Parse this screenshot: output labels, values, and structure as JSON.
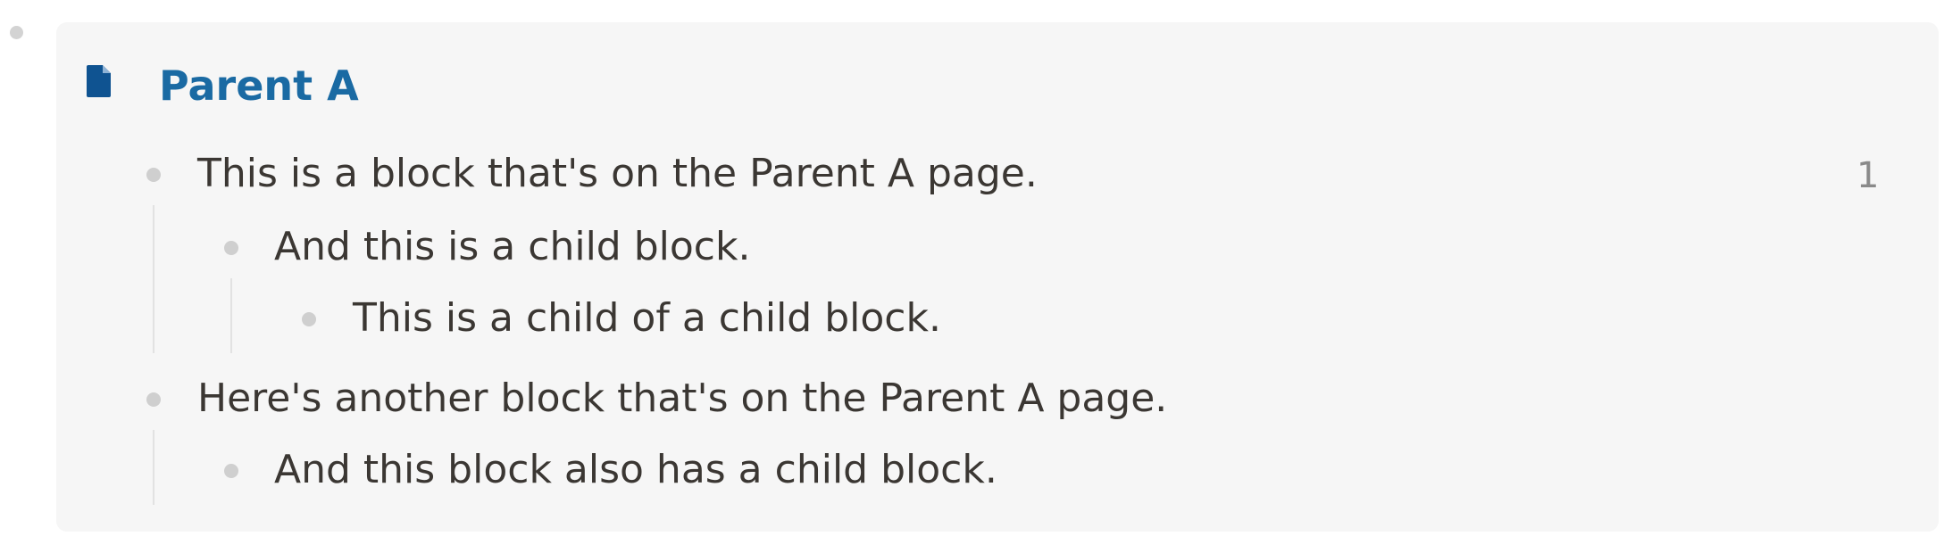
{
  "page": {
    "title": "Parent A",
    "icon": "page-icon"
  },
  "blocks": [
    {
      "text": "This is a block that's on the Parent A page.",
      "depth": 0,
      "ref_count": "1"
    },
    {
      "text": "And this is a child block.",
      "depth": 1
    },
    {
      "text": "This is a child of a child block.",
      "depth": 2
    },
    {
      "text": "Here's another block that's on the Parent A page.",
      "depth": 0
    },
    {
      "text": "And this block also has a child block.",
      "depth": 1
    }
  ],
  "colors": {
    "title": "#1a6aa3",
    "text": "#3b3733",
    "panel_background": "#f6f6f6",
    "bullet": "#cfcfcf"
  }
}
